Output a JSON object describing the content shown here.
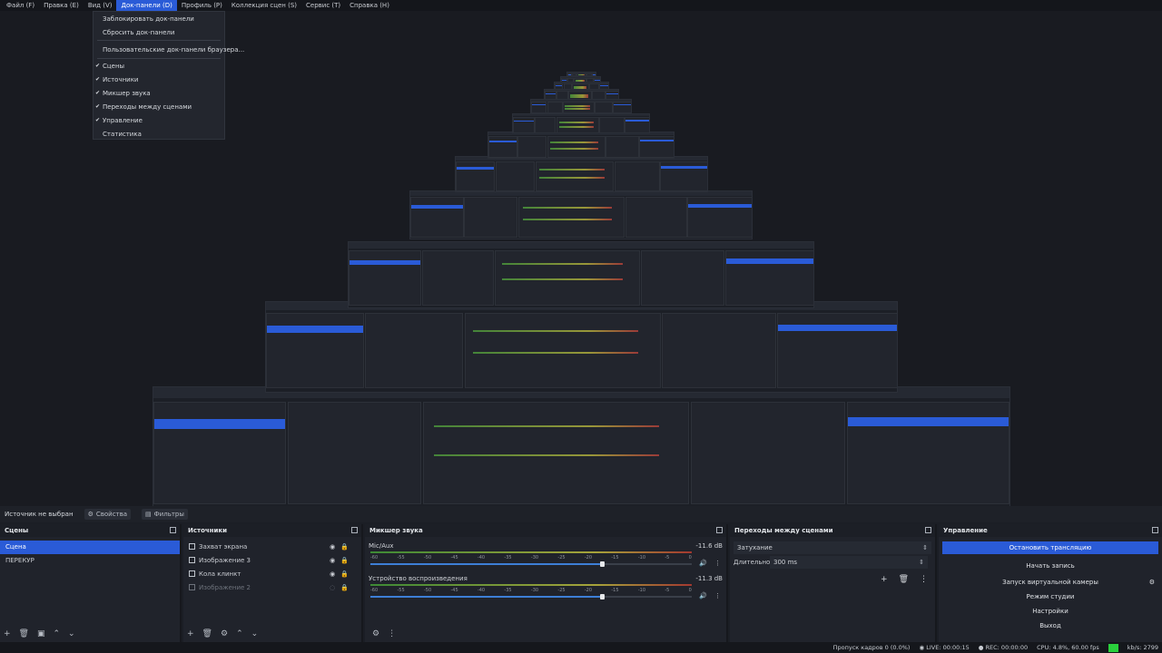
{
  "menubar": {
    "items": [
      "Файл (F)",
      "Правка (E)",
      "Вид (V)",
      "Док-панели (D)",
      "Профиль (P)",
      "Коллекция сцен (S)",
      "Сервис (T)",
      "Справка (H)"
    ],
    "active_index": 3
  },
  "dock_menu": {
    "unlock": "Заблокировать док-панели",
    "reset": "Сбросить док-панели",
    "custom_browser": "Пользовательские док-панели браузера...",
    "toggles": [
      {
        "label": "Сцены",
        "checked": true
      },
      {
        "label": "Источники",
        "checked": true
      },
      {
        "label": "Микшер звука",
        "checked": true
      },
      {
        "label": "Переходы между сценами",
        "checked": true
      },
      {
        "label": "Управление",
        "checked": true
      },
      {
        "label": "Статистика",
        "checked": false
      }
    ]
  },
  "source_bar": {
    "no_source": "Источник не выбран",
    "properties": "Свойства",
    "filters": "Фильтры"
  },
  "scenes": {
    "title": "Сцены",
    "items": [
      "Сцена",
      "ПЕРЕКУР"
    ],
    "selected_index": 0
  },
  "sources": {
    "title": "Источники",
    "items": [
      "Захват экрана",
      "Изображение 3",
      "Кола клинкт",
      "Изображение 2"
    ]
  },
  "mixer": {
    "title": "Микшер звука",
    "ticks": [
      "-60",
      "-55",
      "-50",
      "-45",
      "-40",
      "-35",
      "-30",
      "-25",
      "-20",
      "-15",
      "-10",
      "-5",
      "0"
    ],
    "channels": [
      {
        "name": "Mic/Aux",
        "db": "-11.6 dB",
        "level": 0.72
      },
      {
        "name": "Устройство воспроизведения",
        "db": "-11.3 dB",
        "level": 0.72
      }
    ]
  },
  "transitions": {
    "title": "Переходы между сценами",
    "type": "Затухание",
    "duration_label": "Длительность",
    "duration_value": "300 ms"
  },
  "controls": {
    "title": "Управление",
    "stop_stream": "Остановить трансляцию",
    "start_record": "Начать запись",
    "virtual_cam": "Запуск виртуальной камеры",
    "studio_mode": "Режим студии",
    "settings": "Настройки",
    "exit": "Выход"
  },
  "status": {
    "dropped": "Пропуск кадров 0 (0.0%)",
    "live": "LIVE: 00:00:15",
    "rec": "REC: 00:00:00",
    "cpu": "CPU: 4.8%, 60.00 fps",
    "kbps": "kb/s: 2799"
  },
  "colors": {
    "accent": "#2a5bd7",
    "status_ok": "#2ad03c"
  }
}
